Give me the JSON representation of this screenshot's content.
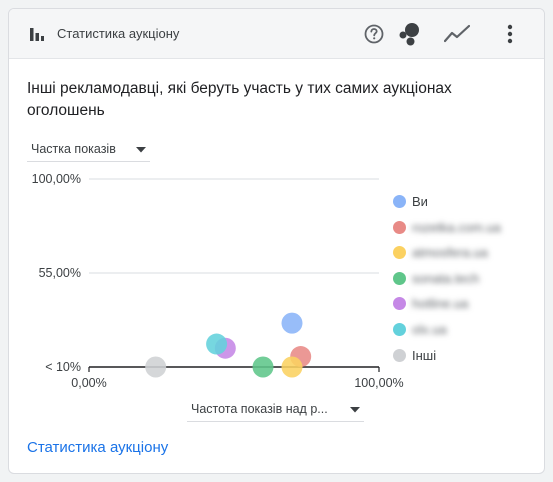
{
  "header": {
    "title": "Статистика аукціону",
    "icons": [
      "bar-chart-icon",
      "help-icon",
      "bubble-chart-icon",
      "trend-line-icon",
      "more-vert-icon"
    ]
  },
  "subtitle": "Інші рекламодавці, які беруть участь у тих самих аукціонах оголошень",
  "y_metric_select": {
    "value": "Частка показів"
  },
  "x_metric_select": {
    "value": "Частота показів над р..."
  },
  "footer_link": "Статистика аукціону",
  "legend": [
    {
      "label": "Ви",
      "color": "#8ab4f8",
      "blurred": false
    },
    {
      "label": "rozetka.com.ua",
      "color": "#e88a86",
      "blurred": true
    },
    {
      "label": "atmosfera.ua",
      "color": "#fbd161",
      "blurred": true
    },
    {
      "label": "sonata.tech",
      "color": "#5fc68a",
      "blurred": true
    },
    {
      "label": "hotline.ua",
      "color": "#c588e6",
      "blurred": true
    },
    {
      "label": "olx.ua",
      "color": "#63d1dc",
      "blurred": true
    },
    {
      "label": "Інші",
      "color": "#cfd1d4",
      "blurred": false
    }
  ],
  "chart_data": {
    "type": "scatter",
    "xlabel": "Частота показів над р...",
    "ylabel": "Частка показів",
    "x_ticks": [
      "0,00%",
      "100,00%"
    ],
    "y_ticks": [
      "< 10%",
      "55,00%",
      "100,00%"
    ],
    "xlim": [
      0,
      100
    ],
    "ylim": [
      10,
      100
    ],
    "grid": true,
    "legend_position": "right",
    "series": [
      {
        "name": "Ви",
        "color": "#8ab4f8",
        "x": 70,
        "y": 31
      },
      {
        "name": "rozetka.com.ua",
        "color": "#e88a86",
        "x": 73,
        "y": 15
      },
      {
        "name": "atmosfera.ua",
        "color": "#fbd161",
        "x": 70,
        "y": 10
      },
      {
        "name": "sonata.tech",
        "color": "#5fc68a",
        "x": 60,
        "y": 10
      },
      {
        "name": "hotline.ua",
        "color": "#c588e6",
        "x": 47,
        "y": 19
      },
      {
        "name": "olx.ua",
        "color": "#63d1dc",
        "x": 44,
        "y": 21
      },
      {
        "name": "Інші",
        "color": "#cfd1d4",
        "x": 23,
        "y": 10
      }
    ]
  }
}
